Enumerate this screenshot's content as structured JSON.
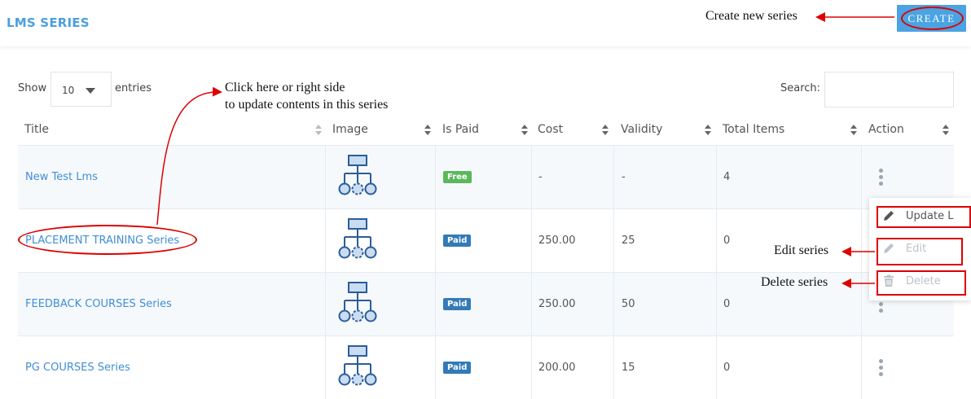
{
  "header": {
    "title": "LMS SERIES",
    "create_label": "CREATE"
  },
  "table_controls": {
    "show_label": "Show",
    "page_length": "10",
    "entries_label": "entries",
    "search_label": "Search:",
    "search_value": ""
  },
  "columns": [
    "Title",
    "Image",
    "Is Paid",
    "Cost",
    "Validity",
    "Total Items",
    "Action"
  ],
  "rows": [
    {
      "title": "New Test Lms",
      "image": "series-hierarchy-icon",
      "is_paid": "Free",
      "cost": "-",
      "validity": "-",
      "total_items": "4"
    },
    {
      "title": "PLACEMENT TRAINING Series",
      "image": "series-hierarchy-icon",
      "is_paid": "Paid",
      "cost": "250.00",
      "validity": "25",
      "total_items": "0"
    },
    {
      "title": "FEEDBACK COURSES Series",
      "image": "series-hierarchy-icon",
      "is_paid": "Paid",
      "cost": "250.00",
      "validity": "50",
      "total_items": "0"
    },
    {
      "title": "PG COURSES Series",
      "image": "series-hierarchy-icon",
      "is_paid": "Paid",
      "cost": "200.00",
      "validity": "15",
      "total_items": "0"
    }
  ],
  "action_menu": {
    "update_label": "Update L",
    "edit_label": "Edit",
    "delete_label": "Delete"
  },
  "annotations": {
    "create": "Create new series",
    "title_line1": "Click here or right side",
    "title_line2": "to update contents in this series",
    "edit": "Edit series",
    "delete": "Delete series"
  },
  "colors": {
    "accent": "#4aa3e2",
    "link": "#3f8ed6",
    "badge_free": "#5cb85c",
    "badge_paid": "#337ab7",
    "annotation_red": "#dd0000"
  }
}
